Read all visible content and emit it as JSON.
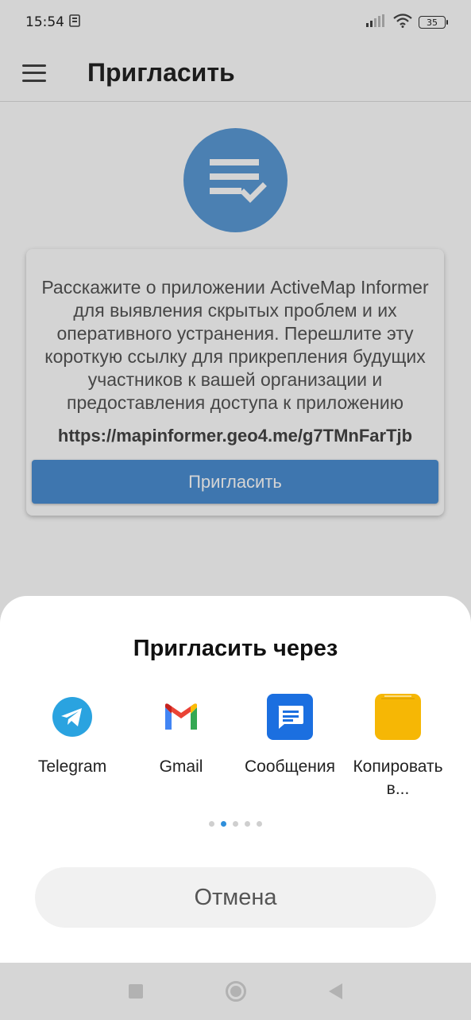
{
  "status_bar": {
    "time": "15:54",
    "battery": "35"
  },
  "toolbar": {
    "title": "Пригласить"
  },
  "card": {
    "description": "Расскажите о приложении ActiveMap Informer для выявления скрытых проблем и их оперативного устранения. Перешлите эту короткую ссылку для прикрепления будущих участников к вашей организации и предоставления доступа к приложению",
    "link": "https://mapinformer.geo4.me/g7TMnFarTjb",
    "button_label": "Пригласить"
  },
  "share_sheet": {
    "title": "Пригласить через",
    "apps": [
      {
        "label": "Telegram",
        "icon": "telegram-icon"
      },
      {
        "label": "Gmail",
        "icon": "gmail-icon"
      },
      {
        "label": "Сообщения",
        "icon": "messages-icon"
      },
      {
        "label": "Копировать в...",
        "icon": "folder-icon"
      }
    ],
    "pages": 5,
    "active_page": 2,
    "cancel_label": "Отмена"
  },
  "colors": {
    "accent": "#4b8fd3",
    "hero": "#5b9ad6",
    "telegram": "#2aa3e0",
    "messages": "#1b6fe0",
    "folder": "#f6b705",
    "page_dot_active": "#2f8fdb"
  }
}
